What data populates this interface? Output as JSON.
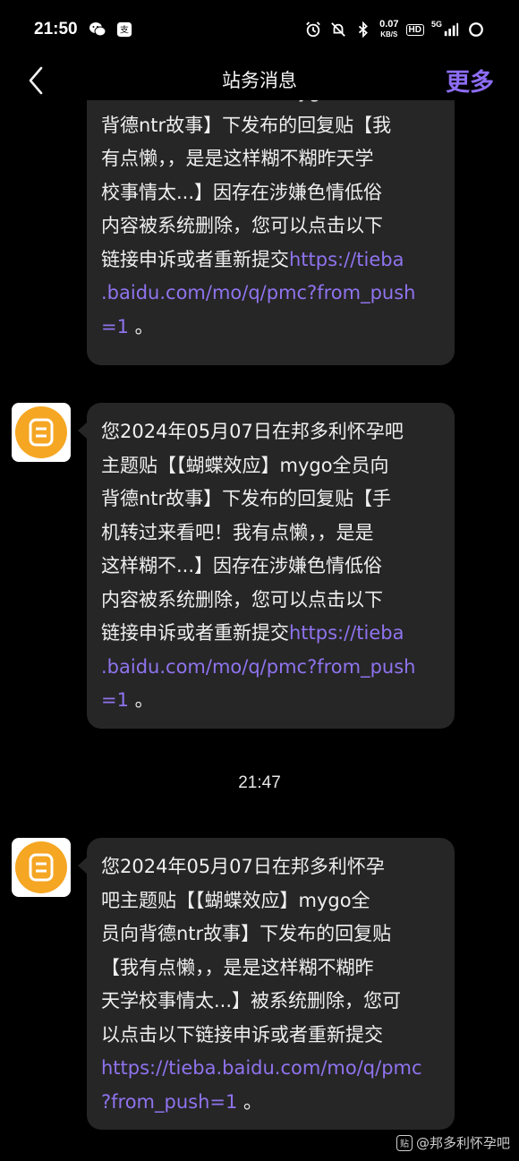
{
  "status_bar": {
    "time": "21:50",
    "net_speed_value": "0.07",
    "net_speed_unit": "KB/S",
    "hd_label": "HD",
    "network_label": "5G"
  },
  "nav": {
    "title": "站务消息",
    "more_label": "更多"
  },
  "messages": [
    {
      "lines": [
        "主题贴【【蝴蝶效应】mygo全员向",
        "背德ntr故事】下发布的回复贴【我",
        "有点懒，，是是这样糊不糊昨天学",
        "校事情太...】因存在涉嫌色情低俗",
        "内容被系统删除，您可以点击以下"
      ],
      "line_with_link_prefix": "链接申诉或者重新提交",
      "link_parts": [
        "https://tieba",
        ".baidu.com/mo/q/pmc?from_push",
        "=1"
      ],
      "suffix": " 。"
    },
    {
      "lines": [
        "您2024年05月07日在邦多利怀孕吧",
        "主题贴【【蝴蝶效应】mygo全员向",
        "背德ntr故事】下发布的回复贴【手",
        "机转过来看吧！我有点懒，，是是",
        "这样糊不...】因存在涉嫌色情低俗",
        "内容被系统删除，您可以点击以下"
      ],
      "line_with_link_prefix": "链接申诉或者重新提交",
      "link_parts": [
        "https://tieba",
        ".baidu.com/mo/q/pmc?from_push",
        "=1"
      ],
      "suffix": " 。"
    },
    {
      "lines": [
        "您2024年05月07日在邦多利怀孕",
        "吧主题贴【【蝴蝶效应】mygo全",
        "员向背德ntr故事】下发布的回复贴",
        "【我有点懒，，是是这样糊不糊昨",
        "天学校事情太...】被系统删除，您可",
        "以点击以下链接申诉或者重新提交"
      ],
      "line_with_link_prefix": "",
      "link_parts": [
        "https://tieba.baidu.com/mo/q/pmc",
        "?from_push=1"
      ],
      "suffix": " 。"
    }
  ],
  "timestamp": "21:47",
  "watermark": "@邦多利怀孕吧",
  "colors": {
    "background": "#000000",
    "bubble": "#262626",
    "link": "#8f73ee",
    "accent": "#8d6df5",
    "avatar": "#f5a623"
  },
  "icons": {
    "back": "chevron-left-icon",
    "avatar": "tieba-notice-icon"
  }
}
